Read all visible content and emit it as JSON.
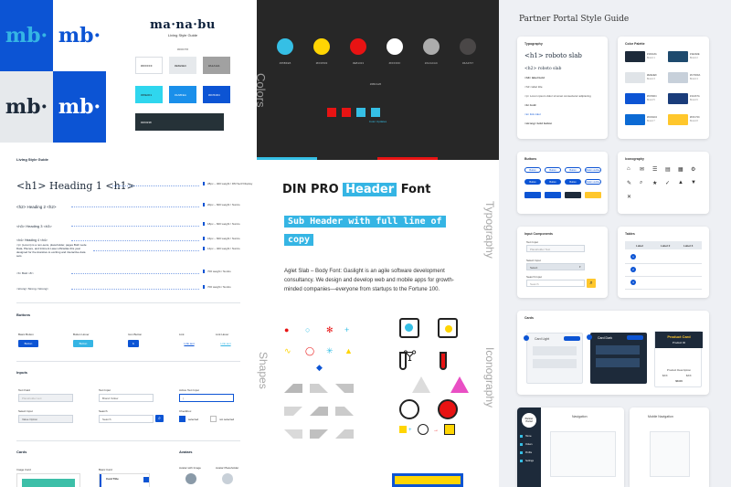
{
  "left": {
    "logo_tiles": [
      {
        "text": "mb",
        "dot": "·",
        "bg": "#0c54d4",
        "fg": "#35b5e4"
      },
      {
        "text": "mb",
        "dot": "·",
        "bg": "#ffffff",
        "fg": "#0c54d4"
      },
      {
        "text": "mb",
        "dot": "·",
        "bg": "#e6e9ec",
        "fg": "#1d2a3a"
      },
      {
        "text": "mb",
        "dot": "·",
        "bg": "#0c54d4",
        "fg": "#ffffff"
      }
    ],
    "brand_title": "ma·na·bu",
    "brand_subtitle": "Living Style Guide",
    "brand_tag": "#ROOT#",
    "swatches": [
      {
        "label": "#FFFFFF",
        "bg": "#ffffff",
        "border": "#d9dde2"
      },
      {
        "label": "#E6E9EC",
        "bg": "#e6e9ec",
        "border": "#e6e9ec"
      },
      {
        "label": "#A1A1A1",
        "bg": "#a1a1a1",
        "border": "#a1a1a1"
      },
      {
        "label": "#35E0F1",
        "bg": "#2fd6ee",
        "border": "#2fd6ee"
      },
      {
        "label": "#1A8FEA",
        "bg": "#1a8fea",
        "border": "#1a8fea"
      },
      {
        "label": "#0C54D4",
        "bg": "#0c54d4",
        "border": "#0c54d4"
      },
      {
        "label": "#263238",
        "bg": "#263238",
        "border": "#263238"
      }
    ],
    "living_heading": "Living Style Guide",
    "type_rows": [
      {
        "text": "<h1> Heading 1 <h1>",
        "size": 11,
        "serif": true,
        "meta": "28px – 400 weight / DM Serif Display"
      },
      {
        "text": "<h2> Heading 2 <h2>",
        "size": 4.5,
        "serif": false,
        "meta": "20px – 600 weight / Nunito"
      },
      {
        "text": "<h3> Heading 3 <h3>",
        "size": 4,
        "serif": false,
        "meta": "18px – 600 weight / Nunito"
      },
      {
        "text": "<h4> Heading 4 <h4>",
        "size": 3.5,
        "serif": false,
        "meta": "16px – 600 weight / Nunito"
      },
      {
        "text": "<p> (Lorem) is a non-sens, placeholder, pages Both Lede Data, Plecere, and Intiment Laser officiellas this year designed for the Assistive to exciting and interactive data sets.",
        "size": 3,
        "serif": false,
        "meta": "14px – 400 weight / Nunito"
      },
      {
        "text": "<b> Bold </b>",
        "size": 3,
        "serif": false,
        "meta": "700 weight / Nunito"
      },
      {
        "text": "<strong> Strong </strong>",
        "size": 3,
        "serif": false,
        "meta": "700 weight / Nunito"
      }
    ],
    "buttons_heading": "Buttons",
    "button_samples": [
      {
        "label": "Basic Button",
        "btn": "Button",
        "bg": "#0c54d4",
        "fg": "#ffffff"
      },
      {
        "label": "Button Hover",
        "btn": "Button",
        "bg": "#35b5e4",
        "fg": "#ffffff"
      },
      {
        "label": "Icon Button",
        "btn": "➤",
        "bg": "#0c54d4",
        "fg": "#ffffff"
      },
      {
        "label": "Link",
        "btn": "Link text",
        "bg": "#ffffff",
        "fg": "#0c54d4"
      },
      {
        "label": "Link Hover",
        "btn": "Link text",
        "bg": "#ffffff",
        "fg": "#35b5e4"
      }
    ],
    "inputs_heading": "Inputs",
    "inputs": [
      {
        "label": "Text Field",
        "value": "Placeholder text"
      },
      {
        "label": "Text Input",
        "value": "Brand Yellow"
      },
      {
        "label": "Active Text Input",
        "value": "|"
      },
      {
        "label": "Select Input",
        "value": "Value Option"
      },
      {
        "label": "Search",
        "value": "Search"
      }
    ],
    "checkbox_label": "Checkbox",
    "checkbox_states": [
      "selected",
      "not selected"
    ],
    "cards_heading": "Cards",
    "avatars_heading": "Avatars",
    "card_samples": [
      "Image Card",
      "Basic Card"
    ],
    "card_inner_title": "Card Title",
    "avatar_samples": [
      "Avatar with Image",
      "Avatar Placeholder"
    ]
  },
  "mid": {
    "colors_title": "Colors",
    "circles": [
      {
        "hex": "#35BFE5",
        "color": "#35bfe5"
      },
      {
        "hex": "#FFD503",
        "color": "#ffd503"
      },
      {
        "hex": "#E81313",
        "color": "#e81313"
      },
      {
        "hex": "#FFFFFF",
        "color": "#ffffff"
      },
      {
        "hex": "#ACACAC",
        "color": "#acacac"
      },
      {
        "hex": "#4A4747",
        "color": "#4a4747"
      }
    ],
    "bg_hex": "#2B2A26",
    "updates_label": "Color Updates",
    "update_squares": [
      "#e81313",
      "#e81313",
      "#35bfe5",
      "#35bfe5"
    ],
    "stripes": [
      "#35bfe5",
      "#272727",
      "#e81313",
      "#272727"
    ],
    "typography_title": "Typography",
    "header_prefix": "DIN PRO",
    "header_highlight": "Header",
    "header_suffix": "Font",
    "subheader": "Sub Header with full line of copy",
    "body_copy": "Aglet Slab – Body Font: Gaslight is an agile software development consultancy. We design and develop web and mobile apps for growth-minded companies—everyone from startups to the Fortune 100.",
    "shapes_title": "Shapes",
    "iconography_title": "Iconography"
  },
  "right": {
    "title": "Partner Portal Style Guide",
    "typography_card": {
      "heading": "Typography",
      "h1": "<h1> roboto slab",
      "h2": "<h2> roboto slab",
      "lines": [
        "<h3> label bold",
        "<h4> label title",
        "<p> Lorem ipsum dolor sit amet consectetur adipiscing",
        "<b> bold",
        "<a> link color",
        "<strong> bold button"
      ]
    },
    "palette_card": {
      "heading": "Color Palette",
      "colors": [
        {
          "hex": "#1D2A3A",
          "name": "Brand 1",
          "color": "#1d2a3a"
        },
        {
          "hex": "#1E4A6E",
          "name": "Brand 2",
          "color": "#1e4a6e"
        },
        {
          "hex": "#E0E4E8",
          "name": "Brand 3",
          "color": "#e0e4e8"
        },
        {
          "hex": "#C7D0DA",
          "name": "Brand 4",
          "color": "#c7d0da"
        },
        {
          "hex": "#0C54D4",
          "name": "Brand 5",
          "color": "#0c54d4"
        },
        {
          "hex": "#1A3C7A",
          "name": "Brand 6",
          "color": "#1a3c7a"
        },
        {
          "hex": "#0C6AD4",
          "name": "Brand 7",
          "color": "#0c6ad4"
        },
        {
          "hex": "#FFC72C",
          "name": "Brand 8",
          "color": "#ffc72c"
        }
      ]
    },
    "buttons_card": {
      "heading": "Buttons",
      "pill_labels": [
        "Button",
        "Button",
        "Button",
        "Button outline"
      ]
    },
    "icons_card": {
      "heading": "Iconography",
      "icons": [
        "⌂",
        "✉",
        "☰",
        "▤",
        "▦",
        "⚙",
        "✎",
        "⌕",
        "★",
        "✓",
        "▲",
        "▼",
        "✕"
      ]
    },
    "inputs_card": {
      "heading": "Input Components",
      "labels": [
        "Text Input",
        "Select Input",
        "Search Input"
      ],
      "values": [
        "Placeholder Text",
        "Select",
        "Search"
      ]
    },
    "tables_card": {
      "heading": "Tables",
      "headers": [
        "Label",
        "Label 2",
        "Label 3"
      ],
      "rows": [
        "1",
        "2",
        "3"
      ]
    },
    "cards_card": {
      "heading": "Cards",
      "light": "Card Light",
      "dark": "Card Dark",
      "product_title": "Product Card",
      "product_id": "Product ID",
      "product_desc": "Product Description",
      "price_labels": [
        "$XX",
        "$XX"
      ],
      "price_value": "$0.00"
    },
    "nav_card": {
      "heading": "Navigation",
      "logo": "Partner Portal",
      "items": [
        "Home",
        "Orders",
        "Profile",
        "Settings"
      ]
    },
    "mobile_nav_card": {
      "heading": "Mobile Navigation"
    }
  }
}
